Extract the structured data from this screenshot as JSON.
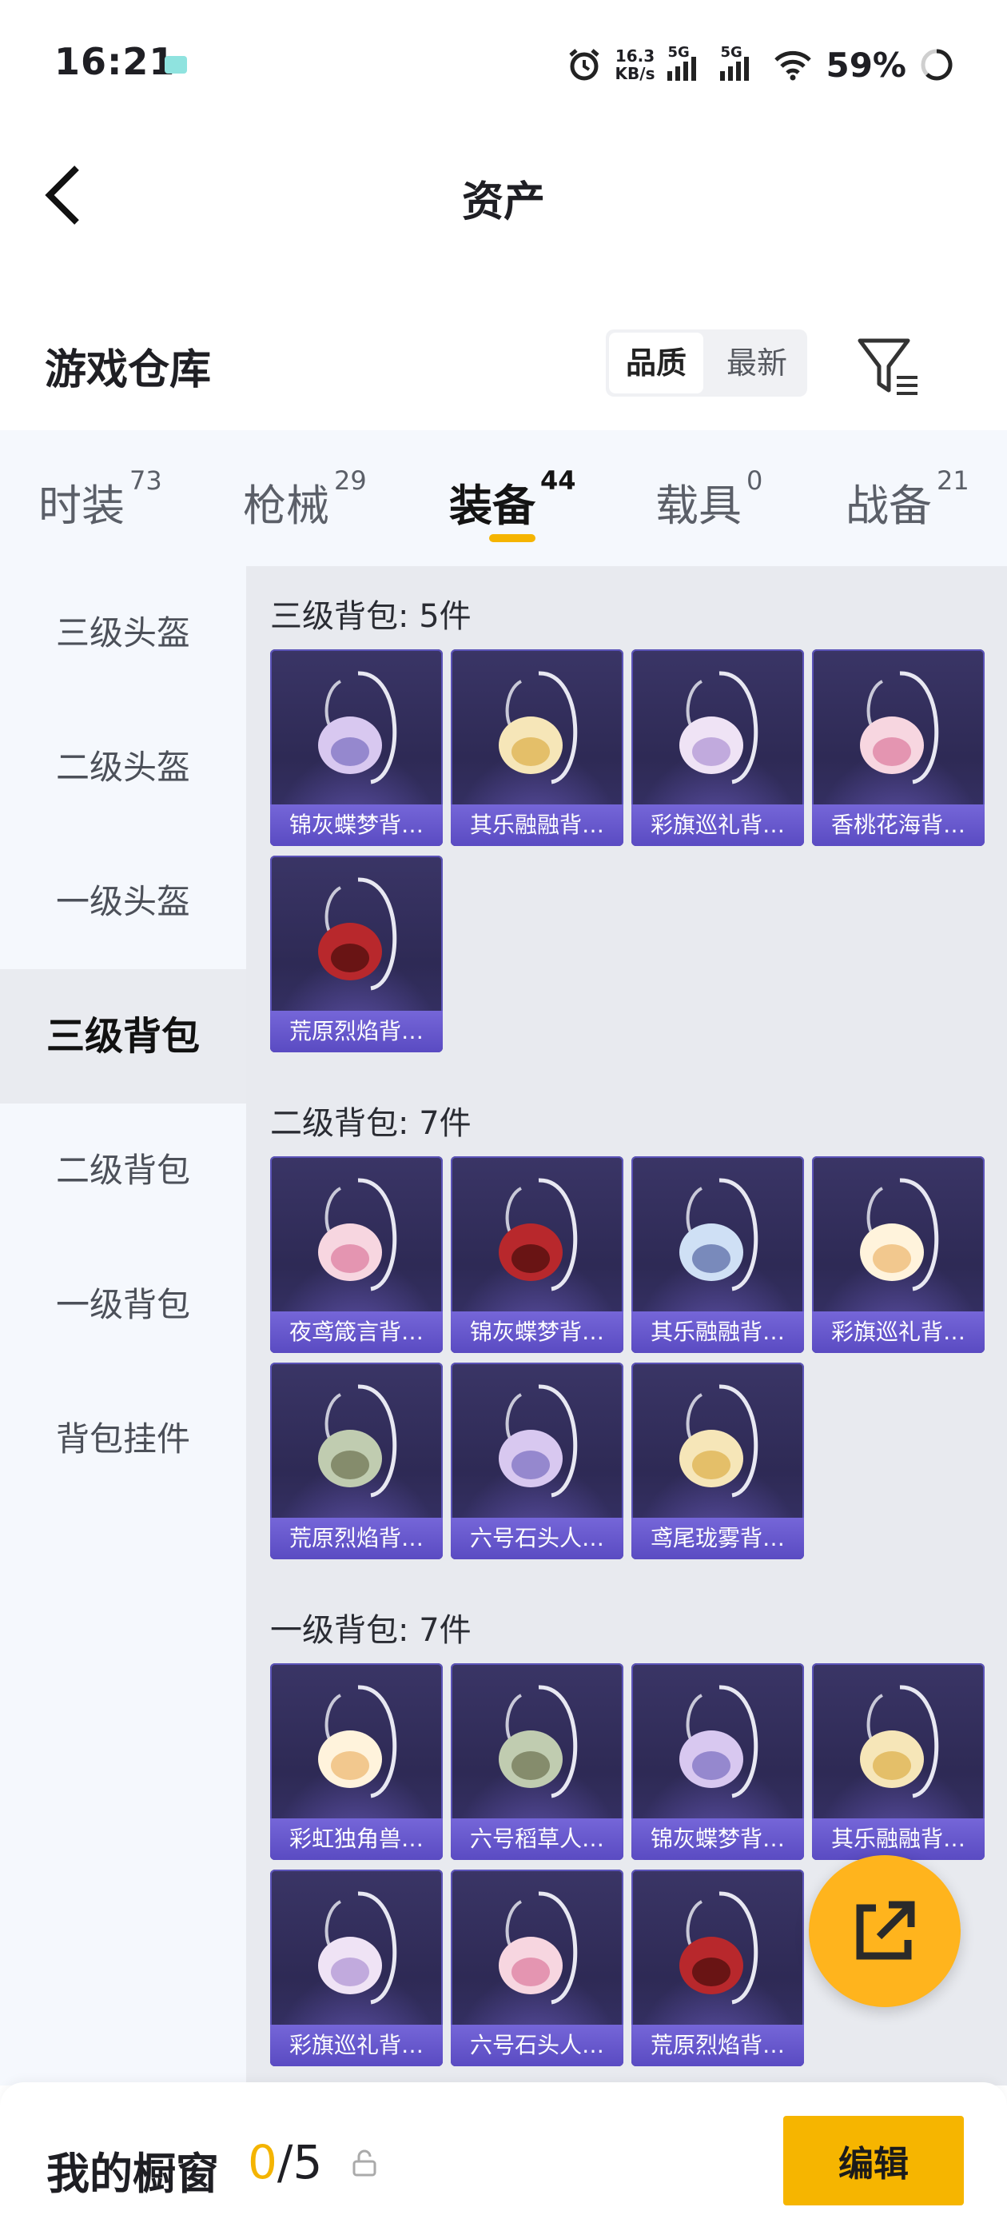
{
  "status_bar": {
    "time": "16:21",
    "net_speed_value": "16.3",
    "net_speed_unit": "KB/s",
    "sig1_label": "5G",
    "sig2_label": "5G",
    "battery": "59%"
  },
  "header": {
    "title": "资产",
    "back_icon": "chevron-left-icon"
  },
  "warehouse": {
    "title": "游戏仓库",
    "sort_options": [
      "品质",
      "最新"
    ],
    "active_sort": "品质",
    "filter_icon": "filter-icon"
  },
  "tabs": [
    {
      "label": "时装",
      "count": "73"
    },
    {
      "label": "枪械",
      "count": "29"
    },
    {
      "label": "装备",
      "count": "44"
    },
    {
      "label": "载具",
      "count": "0"
    },
    {
      "label": "战备",
      "count": "21"
    }
  ],
  "active_tab": "装备",
  "sidebar": {
    "items": [
      "三级头盔",
      "二级头盔",
      "一级头盔",
      "三级背包",
      "二级背包",
      "一级背包",
      "背包挂件"
    ],
    "active": "三级背包"
  },
  "sections": [
    {
      "title": "三级背包: 5件",
      "items": [
        "锦灰蝶梦背…",
        "其乐融融背…",
        "彩旗巡礼背…",
        "香桃花海背…",
        "荒原烈焰背…"
      ]
    },
    {
      "title": "二级背包: 7件",
      "items": [
        "夜鸢箴言背…",
        "锦灰蝶梦背…",
        "其乐融融背…",
        "彩旗巡礼背…",
        "荒原烈焰背…",
        "六号石头人…",
        "鸢尾珑雾背…"
      ]
    },
    {
      "title": "一级背包: 7件",
      "items": [
        "彩虹独角兽…",
        "六号稻草人…",
        "锦灰蝶梦背…",
        "其乐融融背…",
        "彩旗巡礼背…",
        "六号石头人…",
        "荒原烈焰背…"
      ]
    }
  ],
  "share_fab_icon": "share-icon",
  "bottom_bar": {
    "label": "我的橱窗",
    "current": "0",
    "separator": "/",
    "total": "5",
    "lock_icon": "lock-icon",
    "edit_label": "编辑"
  },
  "colors": {
    "accent": "#f6b500",
    "card_bg": "#2e2a55",
    "card_label": "#5a4bc2"
  }
}
